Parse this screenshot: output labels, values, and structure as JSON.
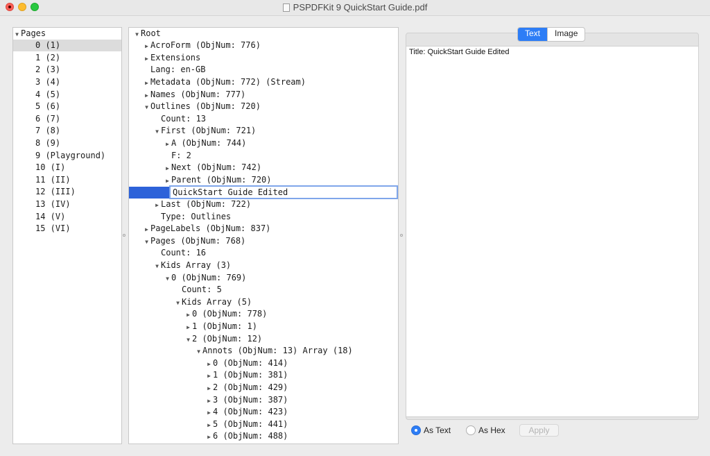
{
  "window": {
    "title": "PSPDFKit 9 QuickStart Guide.pdf"
  },
  "pages_panel": {
    "header": "Pages",
    "items": [
      "0 (1)",
      "1 (2)",
      "2 (3)",
      "3 (4)",
      "4 (5)",
      "5 (6)",
      "6 (7)",
      "7 (8)",
      "8 (9)",
      "9 (Playground)",
      "10 (I)",
      "11 (II)",
      "12 (III)",
      "13 (IV)",
      "14 (V)",
      "15 (VI)"
    ],
    "selected_index": 0
  },
  "tree": {
    "editing_value": "QuickStart Guide Edited",
    "nodes": [
      {
        "text": "Root",
        "tri": "▼"
      },
      {
        "text": "AcroForm (ObjNum: 776)",
        "tri": "▶"
      },
      {
        "text": "Extensions",
        "tri": "▶"
      },
      {
        "text": "Lang: en-GB",
        "tri": ""
      },
      {
        "text": "Metadata (ObjNum: 772) (Stream)",
        "tri": "▶"
      },
      {
        "text": "Names (ObjNum: 777)",
        "tri": "▶"
      },
      {
        "text": "Outlines (ObjNum: 720)",
        "tri": "▼"
      },
      {
        "text": "Count: 13",
        "tri": ""
      },
      {
        "text": "First (ObjNum: 721)",
        "tri": "▼"
      },
      {
        "text": "A (ObjNum: 744)",
        "tri": "▶"
      },
      {
        "text": "F: 2",
        "tri": ""
      },
      {
        "text": "Next (ObjNum: 742)",
        "tri": "▶"
      },
      {
        "text": "Parent (ObjNum: 720)",
        "tri": "▶"
      },
      {
        "text": "",
        "tri": ""
      },
      {
        "text": "Last (ObjNum: 722)",
        "tri": "▶"
      },
      {
        "text": "Type: Outlines",
        "tri": ""
      },
      {
        "text": "PageLabels (ObjNum: 837)",
        "tri": "▶"
      },
      {
        "text": "Pages (ObjNum: 768)",
        "tri": "▼"
      },
      {
        "text": "Count: 16",
        "tri": ""
      },
      {
        "text": "Kids Array (3)",
        "tri": "▼"
      },
      {
        "text": "0 (ObjNum: 769)",
        "tri": "▼"
      },
      {
        "text": "Count: 5",
        "tri": ""
      },
      {
        "text": "Kids Array (5)",
        "tri": "▼"
      },
      {
        "text": "0 (ObjNum: 778)",
        "tri": "▶"
      },
      {
        "text": "1 (ObjNum: 1)",
        "tri": "▶"
      },
      {
        "text": "2 (ObjNum: 12)",
        "tri": "▼"
      },
      {
        "text": "Annots (ObjNum: 13) Array (18)",
        "tri": "▼"
      },
      {
        "text": "0 (ObjNum: 414)",
        "tri": "▶"
      },
      {
        "text": "1 (ObjNum: 381)",
        "tri": "▶"
      },
      {
        "text": "2 (ObjNum: 429)",
        "tri": "▶"
      },
      {
        "text": "3 (ObjNum: 387)",
        "tri": "▶"
      },
      {
        "text": "4 (ObjNum: 423)",
        "tri": "▶"
      },
      {
        "text": "5 (ObjNum: 441)",
        "tri": "▶"
      },
      {
        "text": "6 (ObjNum: 488)",
        "tri": "▶"
      }
    ]
  },
  "detail": {
    "tabs": [
      "Text",
      "Image"
    ],
    "active_tab": "Text",
    "content": "Title: QuickStart Guide Edited",
    "radio_as_text": "As Text",
    "radio_as_hex": "As Hex",
    "selected_radio": "As Text",
    "apply_label": "Apply"
  },
  "colors": {
    "accent": "#2d7df6",
    "selection": "#2d62d9"
  }
}
